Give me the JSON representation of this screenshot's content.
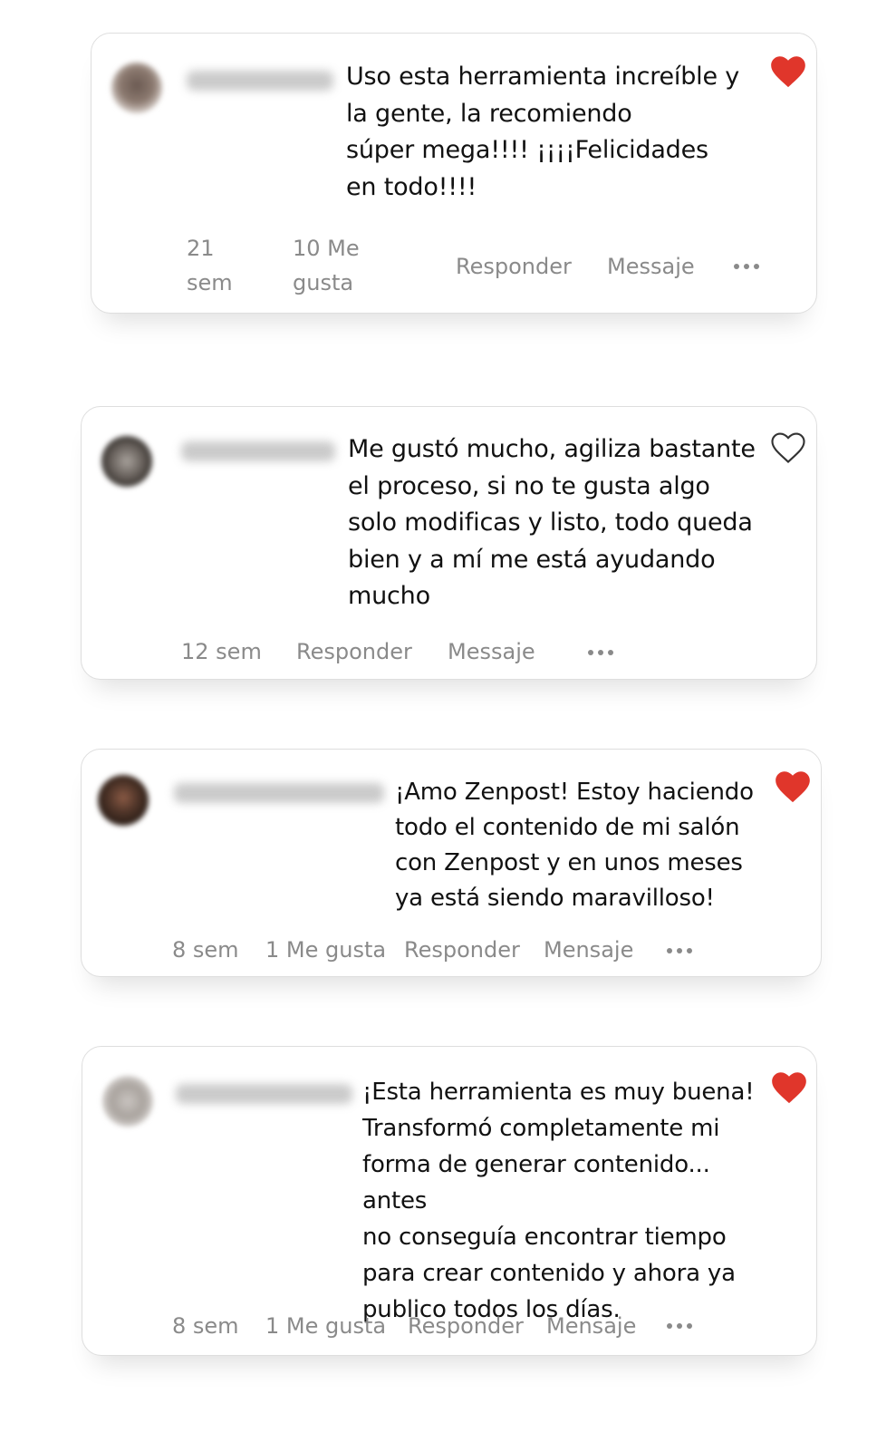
{
  "colors": {
    "liked_heart": "#e0362b",
    "meta_text": "#8a8a8a",
    "body_text": "#111111",
    "card_border": "#dedede"
  },
  "comments": [
    {
      "username": "caminou788",
      "liked": true,
      "lines": [
        "Uso esta herramienta increíble y",
        "la gente, la recomiendo",
        "súper mega!!!! ¡¡¡¡Felicidades",
        "en todo!!!!"
      ],
      "time": "21 sem",
      "likes": "10 Me gusta",
      "reply": "Responder",
      "message": "Messaje",
      "more_icon": "ellipsis-icon",
      "heart_icon": "heart-filled-icon"
    },
    {
      "username": "rodriguezwdu",
      "liked": false,
      "lines": [
        "Me gustó mucho, agiliza bastante",
        "el proceso, si no te gusta algo",
        "solo modificas y listo, todo queda",
        "bien y a mí me está ayudando",
        "mucho"
      ],
      "time": "12 sem",
      "reply": "Responder",
      "message": "Messaje",
      "more_icon": "ellipsis-icon",
      "heart_icon": "heart-outline-icon"
    },
    {
      "username": "salonchanossalon",
      "liked": true,
      "lines": [
        "¡Amo Zenpost! Estoy haciendo",
        "todo el contenido de mi salón",
        "con Zenpost y en unos meses",
        "ya está siendo maravilloso!"
      ],
      "time": "8 sem",
      "likes": "1 Me gusta",
      "reply": "Responder",
      "message": "Mensaje",
      "more_icon": "ellipsis-icon",
      "heart_icon": "heart-filled-icon"
    },
    {
      "username": "catohonorann",
      "liked": true,
      "lines": [
        "¡Esta herramienta es muy buena!",
        "Transformó completamente mi",
        "forma de generar contenido... antes",
        "no conseguía encontrar tiempo",
        "para crear contenido y ahora ya",
        "publico todos los días."
      ],
      "time": "8 sem",
      "likes": "1 Me gusta",
      "reply": "Responder",
      "message": "Mensaje",
      "more_icon": "ellipsis-icon",
      "heart_icon": "heart-filled-icon"
    }
  ]
}
